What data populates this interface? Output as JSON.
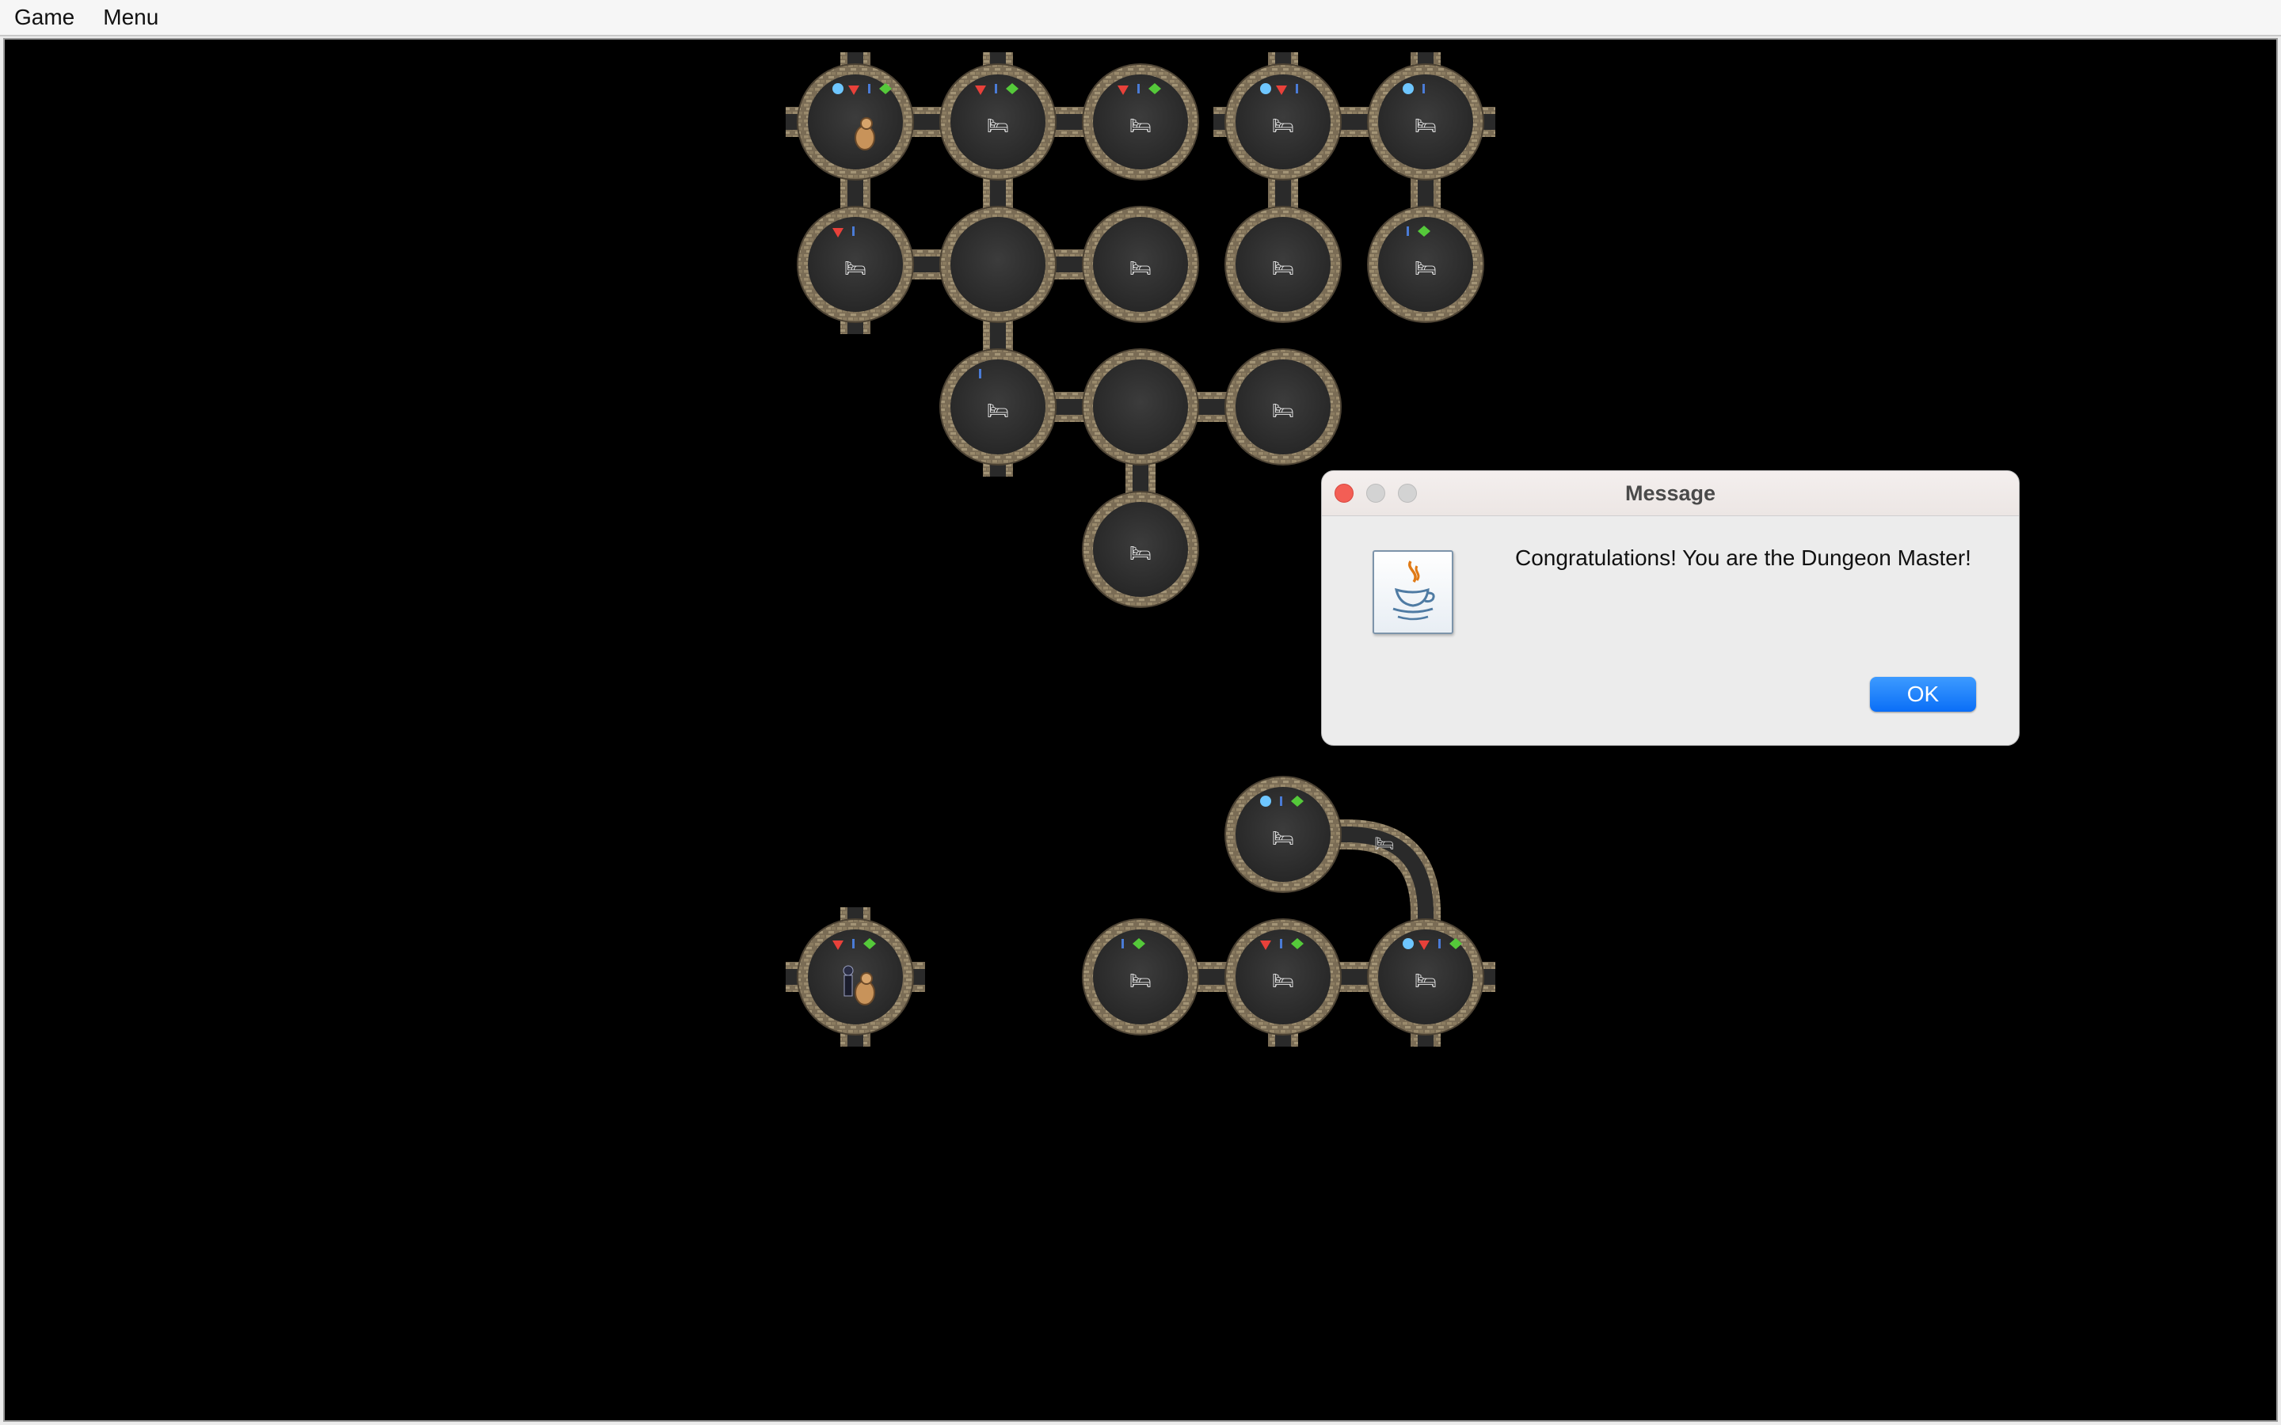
{
  "menubar": {
    "items": [
      "Game",
      "Menu"
    ]
  },
  "dialog": {
    "title": "Message",
    "icon": "java-coffee-cup-icon",
    "message": "Congratulations! You are the Dungeon Master!",
    "ok_label": "OK"
  },
  "dungeon": {
    "grid": {
      "cols": 5,
      "rows": 7
    },
    "rooms": [
      {
        "col": 0,
        "row": 0,
        "exits": [
          "N",
          "S",
          "E",
          "W"
        ],
        "items": [
          "sapphire",
          "ruby",
          "arrow",
          "emerald"
        ],
        "occupant": "monster"
      },
      {
        "col": 1,
        "row": 0,
        "exits": [
          "N",
          "S",
          "E",
          "W"
        ],
        "items": [
          "ruby",
          "arrow",
          "emerald"
        ],
        "bed": true
      },
      {
        "col": 2,
        "row": 0,
        "exits": [
          "W"
        ],
        "items": [
          "ruby",
          "arrow",
          "emerald"
        ],
        "bed": true
      },
      {
        "col": 3,
        "row": 0,
        "exits": [
          "N",
          "S",
          "E",
          "W"
        ],
        "items": [
          "sapphire",
          "ruby",
          "arrow"
        ],
        "bed": true
      },
      {
        "col": 4,
        "row": 0,
        "exits": [
          "N",
          "S",
          "E",
          "W"
        ],
        "items": [
          "sapphire",
          "arrow"
        ],
        "bed": true
      },
      {
        "col": 0,
        "row": 1,
        "exits": [
          "N",
          "S",
          "E"
        ],
        "items": [
          "ruby",
          "arrow"
        ],
        "bed": true
      },
      {
        "col": 1,
        "row": 1,
        "exits": [
          "N",
          "S",
          "E",
          "W"
        ],
        "items": []
      },
      {
        "col": 2,
        "row": 1,
        "exits": [
          "W"
        ],
        "items": [],
        "bed": true
      },
      {
        "col": 3,
        "row": 1,
        "exits": [
          "N"
        ],
        "items": [],
        "bed": true
      },
      {
        "col": 4,
        "row": 1,
        "exits": [
          "N"
        ],
        "items": [
          "arrow",
          "emerald"
        ],
        "bed": true
      },
      {
        "col": 1,
        "row": 2,
        "exits": [
          "N",
          "S",
          "E"
        ],
        "items": [
          "arrow"
        ],
        "bed": true
      },
      {
        "col": 2,
        "row": 2,
        "exits": [
          "S",
          "E",
          "W"
        ],
        "items": []
      },
      {
        "col": 3,
        "row": 2,
        "exits": [
          "W"
        ],
        "items": [],
        "bed": true
      },
      {
        "col": 2,
        "row": 3,
        "exits": [
          "N"
        ],
        "items": [],
        "bed": true
      },
      {
        "col": 3,
        "row": 5,
        "exits": [
          "E"
        ],
        "items": [
          "sapphire",
          "arrow",
          "emerald"
        ],
        "bed": true
      },
      {
        "col": 0,
        "row": 6,
        "exits": [
          "N",
          "S",
          "E",
          "W"
        ],
        "items": [
          "ruby",
          "arrow",
          "emerald"
        ],
        "occupant": "adventurer-and-monster"
      },
      {
        "col": 2,
        "row": 6,
        "exits": [
          "E"
        ],
        "items": [
          "arrow",
          "emerald"
        ],
        "bed": true
      },
      {
        "col": 3,
        "row": 6,
        "exits": [
          "S",
          "E",
          "W"
        ],
        "items": [
          "ruby",
          "arrow",
          "emerald"
        ],
        "bed": true
      },
      {
        "col": 4,
        "row": 6,
        "exits": [
          "N",
          "S",
          "E",
          "W"
        ],
        "items": [
          "sapphire",
          "ruby",
          "arrow",
          "emerald"
        ],
        "bed": true
      }
    ],
    "corridors": [
      {
        "from": [
          0,
          0
        ],
        "to": [
          1,
          0
        ]
      },
      {
        "from": [
          1,
          0
        ],
        "to": [
          2,
          0
        ]
      },
      {
        "from": [
          3,
          0
        ],
        "to": [
          4,
          0
        ]
      },
      {
        "from": [
          0,
          0
        ],
        "to": [
          0,
          1
        ]
      },
      {
        "from": [
          1,
          0
        ],
        "to": [
          1,
          1
        ]
      },
      {
        "from": [
          3,
          0
        ],
        "to": [
          3,
          1
        ]
      },
      {
        "from": [
          4,
          0
        ],
        "to": [
          4,
          1
        ]
      },
      {
        "from": [
          0,
          1
        ],
        "to": [
          1,
          1
        ]
      },
      {
        "from": [
          1,
          1
        ],
        "to": [
          2,
          1
        ]
      },
      {
        "from": [
          1,
          1
        ],
        "to": [
          1,
          2
        ]
      },
      {
        "from": [
          1,
          2
        ],
        "to": [
          2,
          2
        ]
      },
      {
        "from": [
          2,
          2
        ],
        "to": [
          3,
          2
        ]
      },
      {
        "from": [
          2,
          2
        ],
        "to": [
          2,
          3
        ]
      },
      {
        "from": [
          2,
          6
        ],
        "to": [
          3,
          6
        ]
      },
      {
        "from": [
          3,
          6
        ],
        "to": [
          4,
          6
        ]
      },
      {
        "from": [
          3,
          5
        ],
        "to": [
          4,
          6
        ],
        "curved": true
      }
    ]
  }
}
